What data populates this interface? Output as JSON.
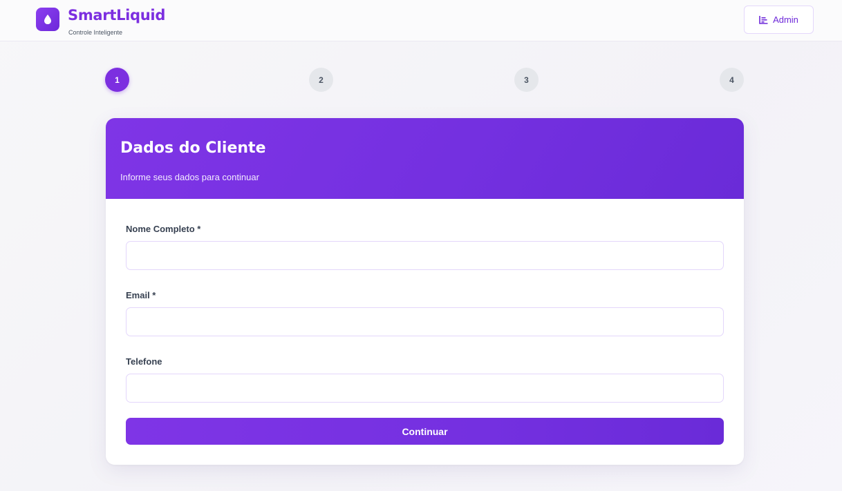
{
  "header": {
    "brand_name": "SmartLiquid",
    "brand_subtitle": "Controle Inteligente",
    "logo_icon": "droplet-icon",
    "admin_label": "Admin",
    "admin_icon": "chart-bar-icon"
  },
  "stepper": {
    "steps": [
      "1",
      "2",
      "3",
      "4"
    ],
    "active_step": "1"
  },
  "card": {
    "title": "Dados do Cliente",
    "subtitle": "Informe seus dados para continuar",
    "fields": [
      {
        "label": "Nome Completo *",
        "value": "",
        "placeholder": ""
      },
      {
        "label": "Email *",
        "value": "",
        "placeholder": ""
      },
      {
        "label": "Telefone",
        "value": "",
        "placeholder": ""
      }
    ],
    "submit_label": "Continuar"
  },
  "colors": {
    "accent": "#7c2fe0",
    "accent_dark": "#6d28d9",
    "step_inactive": "#e5e7eb",
    "input_border": "#e3d6fb"
  }
}
